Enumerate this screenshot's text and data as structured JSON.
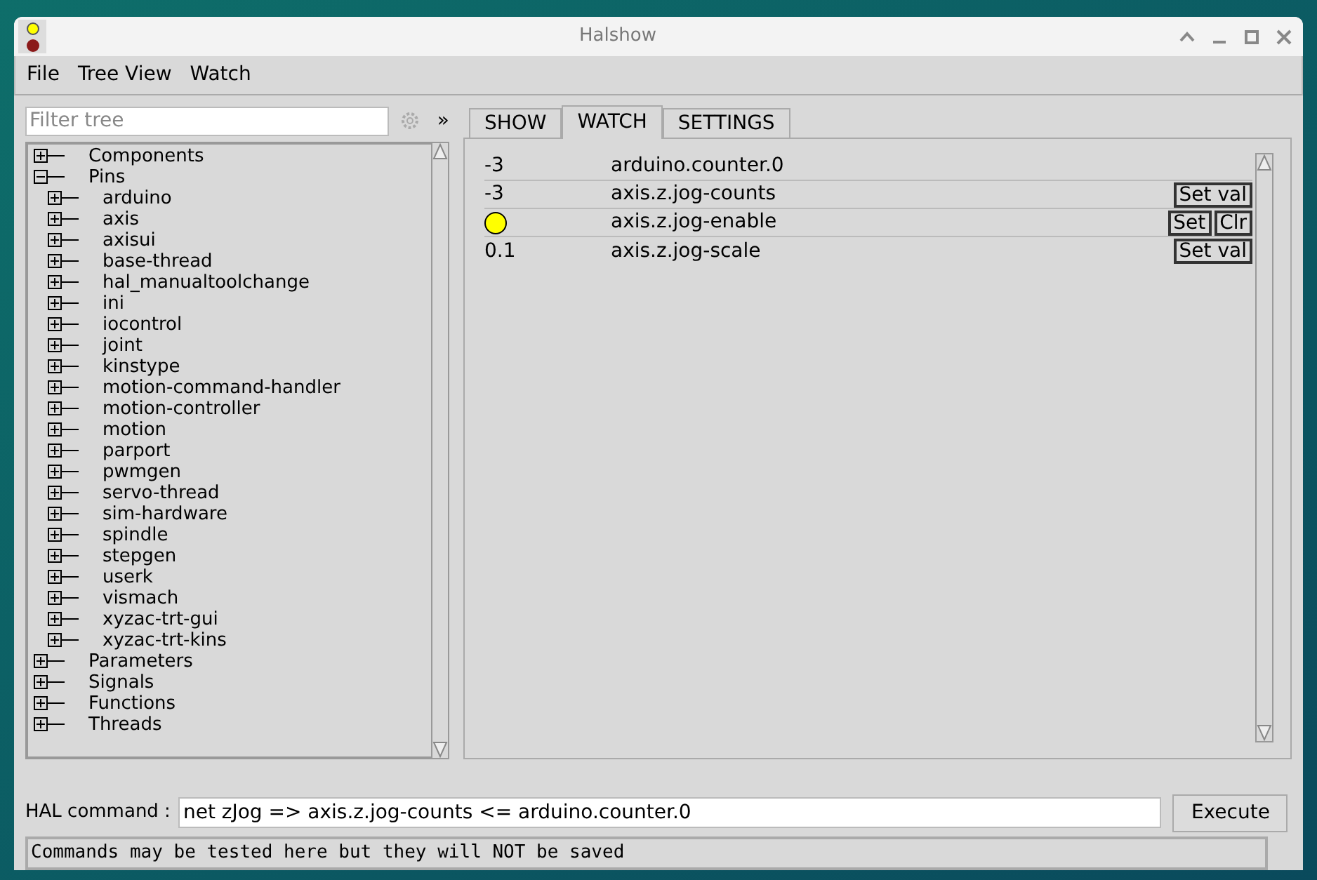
{
  "window": {
    "title": "Halshow"
  },
  "menu": [
    "File",
    "Tree View",
    "Watch"
  ],
  "filter": {
    "placeholder": "Filter tree",
    "more": "»"
  },
  "tree": [
    {
      "label": "Components",
      "expanded": false
    },
    {
      "label": "Pins",
      "expanded": true,
      "children": [
        {
          "label": "arduino"
        },
        {
          "label": "axis"
        },
        {
          "label": "axisui"
        },
        {
          "label": "base-thread"
        },
        {
          "label": "hal_manualtoolchange"
        },
        {
          "label": "ini"
        },
        {
          "label": "iocontrol"
        },
        {
          "label": "joint"
        },
        {
          "label": "kinstype"
        },
        {
          "label": "motion-command-handler"
        },
        {
          "label": "motion-controller"
        },
        {
          "label": "motion"
        },
        {
          "label": "parport"
        },
        {
          "label": "pwmgen"
        },
        {
          "label": "servo-thread"
        },
        {
          "label": "sim-hardware"
        },
        {
          "label": "spindle"
        },
        {
          "label": "stepgen"
        },
        {
          "label": "userk"
        },
        {
          "label": "vismach"
        },
        {
          "label": "xyzac-trt-gui"
        },
        {
          "label": "xyzac-trt-kins"
        }
      ]
    },
    {
      "label": "Parameters",
      "expanded": false
    },
    {
      "label": "Signals",
      "expanded": false
    },
    {
      "label": "Functions",
      "expanded": false
    },
    {
      "label": "Threads",
      "expanded": false
    }
  ],
  "tabs": [
    {
      "label": "SHOW",
      "selected": false
    },
    {
      "label": "WATCH",
      "selected": true
    },
    {
      "label": "SETTINGS",
      "selected": false
    }
  ],
  "watch": [
    {
      "kind": "value",
      "value": "-3",
      "name": "arduino.counter.0"
    },
    {
      "kind": "value",
      "value": "-3",
      "name": "axis.z.jog-counts",
      "buttons": [
        "Set val"
      ]
    },
    {
      "kind": "bit",
      "on": true,
      "name": "axis.z.jog-enable",
      "buttons": [
        "Set",
        "Clr"
      ]
    },
    {
      "kind": "value",
      "value": "0.1",
      "name": "axis.z.jog-scale",
      "buttons": [
        "Set val"
      ]
    }
  ],
  "command": {
    "label": "HAL command :",
    "value": "net zJog => axis.z.jog-counts <= arduino.counter.0",
    "button": "Execute"
  },
  "status_bar": "Commands may be tested here but they will NOT be saved"
}
